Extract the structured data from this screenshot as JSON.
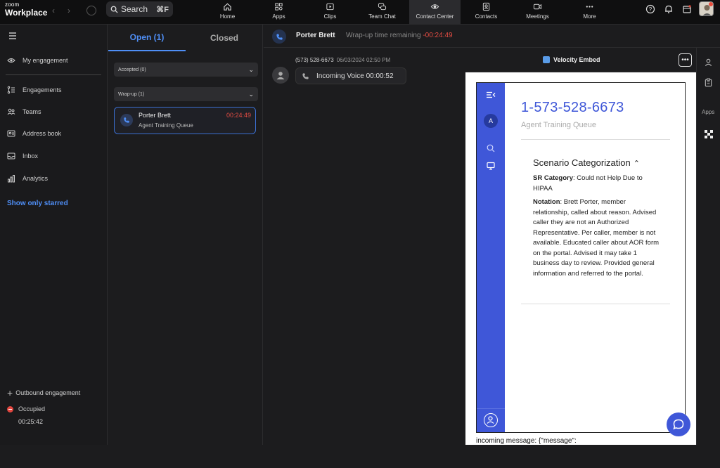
{
  "app": {
    "brand_small": "zoom",
    "brand_large": "Workplace"
  },
  "search": {
    "label": "Search",
    "shortcut": "⌘F"
  },
  "nav_tabs": [
    {
      "label": "Home",
      "icon": "home-icon"
    },
    {
      "label": "Apps",
      "icon": "apps-icon"
    },
    {
      "label": "Clips",
      "icon": "clips-icon"
    },
    {
      "label": "Team Chat",
      "icon": "chat-icon"
    },
    {
      "label": "Contact Center",
      "icon": "contact-center-icon",
      "active": true
    },
    {
      "label": "Contacts",
      "icon": "contacts-icon"
    },
    {
      "label": "Meetings",
      "icon": "meetings-icon"
    },
    {
      "label": "More",
      "icon": "more-icon"
    }
  ],
  "sidebar": {
    "items": [
      {
        "label": "My engagement",
        "icon": "eye-icon"
      },
      {
        "label": "Engagements",
        "icon": "list-icon"
      },
      {
        "label": "Teams",
        "icon": "teams-icon"
      },
      {
        "label": "Address book",
        "icon": "address-book-icon"
      },
      {
        "label": "Inbox",
        "icon": "inbox-icon"
      },
      {
        "label": "Analytics",
        "icon": "analytics-icon"
      }
    ],
    "starred_label": "Show only starred",
    "outbound_label": "Outbound engagement",
    "status_label": "Occupied",
    "status_timer": "00:25:42"
  },
  "list": {
    "tab_open": "Open (1)",
    "tab_closed": "Closed",
    "group_accepted": "Accepted (0)",
    "group_wrapup": "Wrap-up (1)",
    "card": {
      "name": "Porter Brett",
      "timer": "00:24:49",
      "queue": "Agent Training Queue"
    }
  },
  "conversation": {
    "name": "Porter Brett",
    "wrapup_label": "Wrap-up time remaining",
    "wrapup_timer": "-00:24:49",
    "msg_number": "(573) 528-6673",
    "msg_time": "06/03/2024 02:50 PM",
    "msg_text": "Incoming Voice 00:00:52"
  },
  "embed": {
    "title": "Velocity Embed",
    "more": "•••",
    "rail_avatar": "A",
    "phone": "1-573-528-6673",
    "queue": "Agent Training Queue",
    "scenario_title": "Scenario Categorization",
    "sr_label": "SR Category",
    "sr_value": ": Could not Help Due to HIPAA",
    "notation_label": "Notation",
    "notation_value": ": Brett Porter, member relationship, called about reason. Advised caller they are not an Authorized Representative. Per caller, member is not available. Educated caller about AOR form on the portal. Advised it may take 1 business day to review. Provided general information and referred to the portal.",
    "incoming_message": "incoming message: {\"message\":"
  },
  "right_strip": {
    "apps_label": "Apps"
  },
  "colors": {
    "accent": "#4f8ff7",
    "embed_blue": "#3f57d8",
    "alert_red": "#e34c43"
  }
}
